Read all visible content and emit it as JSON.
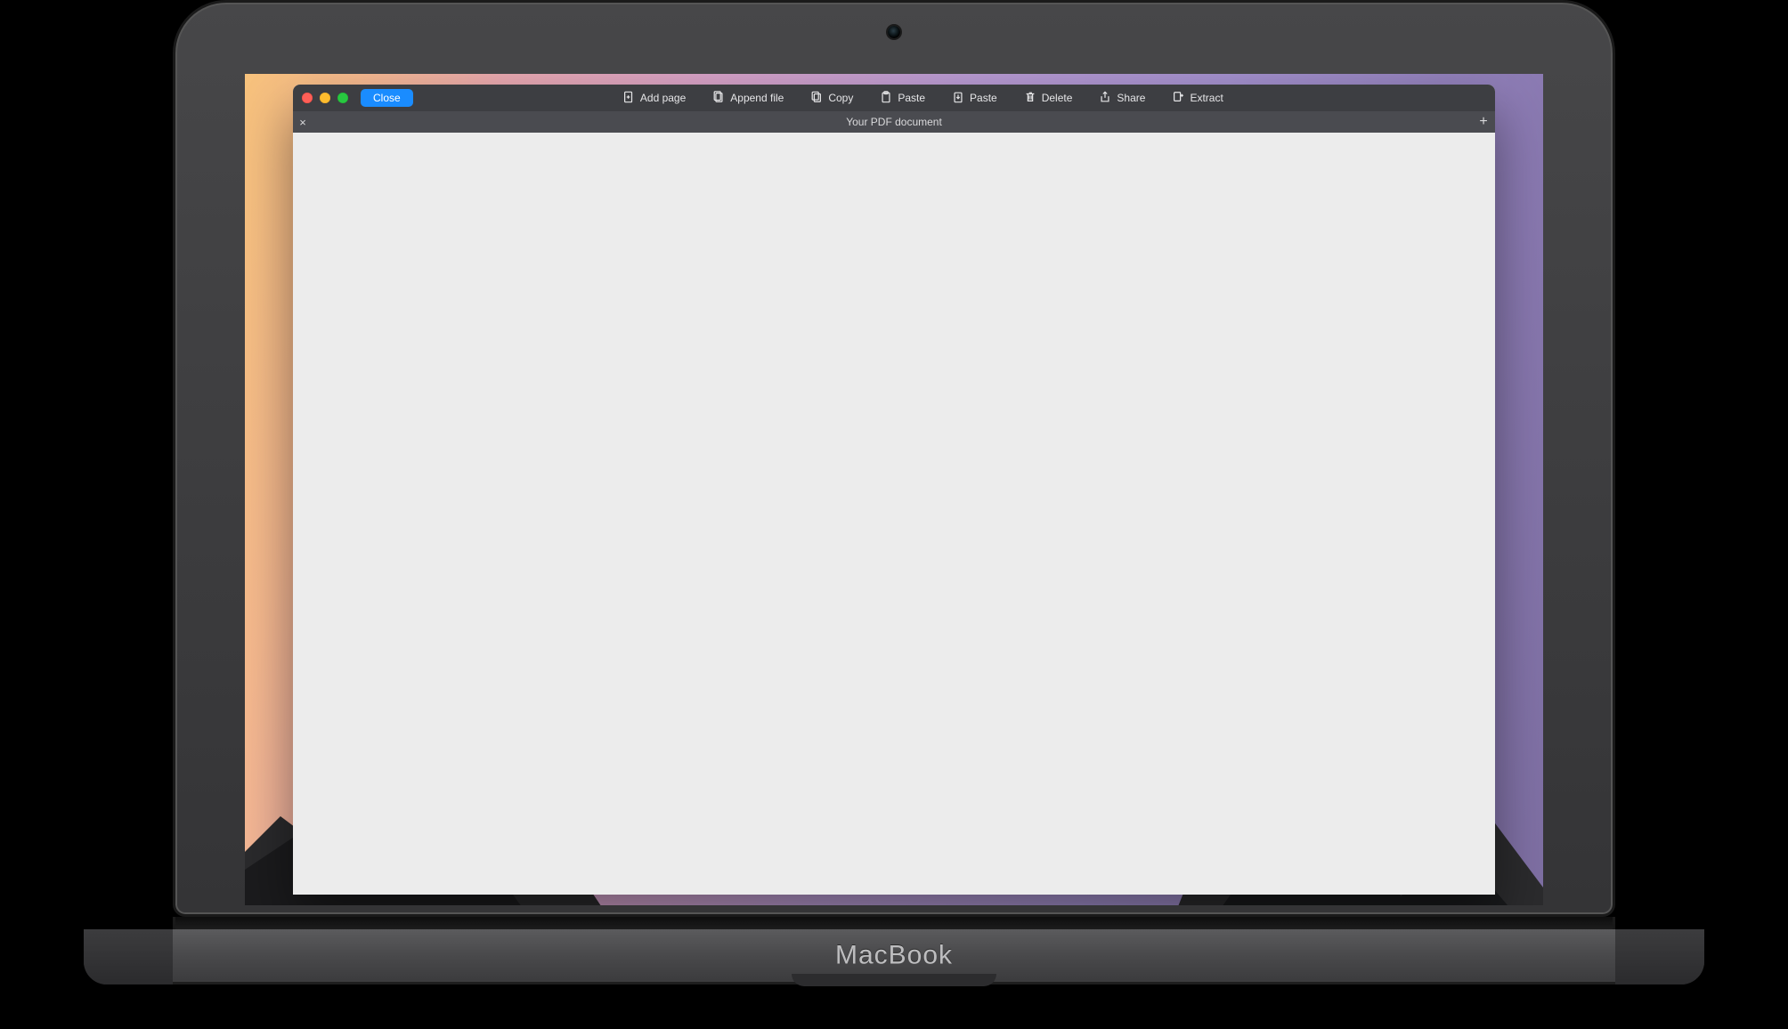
{
  "device_brand": "MacBook",
  "window": {
    "close_button": "Close",
    "toolbar": {
      "add_page": "Add page",
      "append_file": "Append file",
      "copy": "Copy",
      "paste1": "Paste",
      "paste2": "Paste",
      "delete": "Delete",
      "share": "Share",
      "extract": "Extract"
    },
    "tab_title": "Your PDF document",
    "icons": {
      "tab_close": "×",
      "tab_add": "+"
    }
  }
}
